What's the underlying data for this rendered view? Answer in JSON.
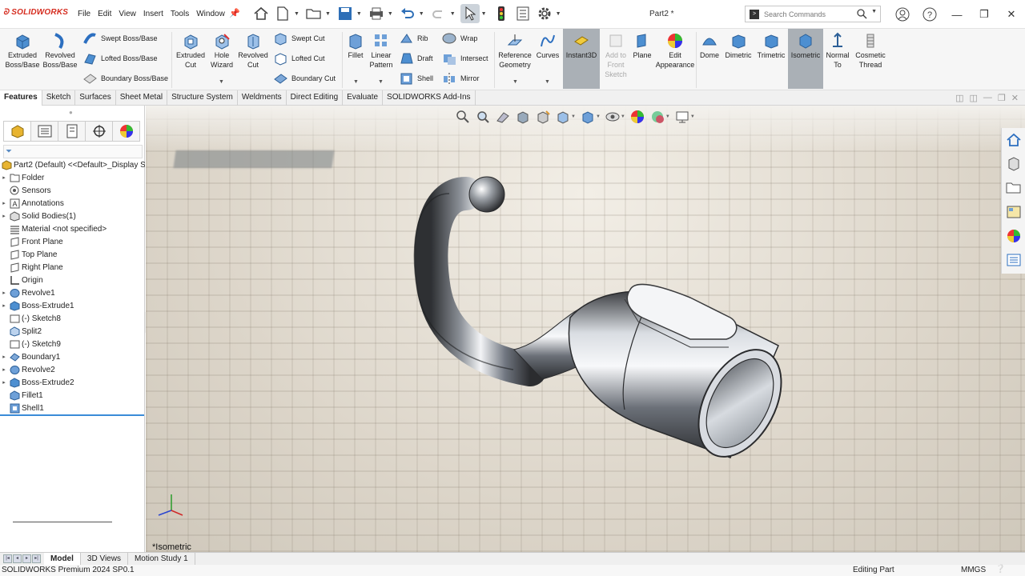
{
  "app": {
    "logo": "SOLIDWORKS",
    "title": "Part2 *"
  },
  "menus": [
    "File",
    "Edit",
    "View",
    "Insert",
    "Tools",
    "Window"
  ],
  "search": {
    "placeholder": "Search Commands"
  },
  "ribbon": {
    "extruded_boss": "Extruded Boss/Base",
    "revolved_boss": "Revolved Boss/Base",
    "swept_boss": "Swept Boss/Base",
    "lofted_boss": "Lofted Boss/Base",
    "boundary_boss": "Boundary Boss/Base",
    "extruded_cut": "Extruded Cut",
    "hole_wizard": "Hole Wizard",
    "revolved_cut": "Revolved Cut",
    "swept_cut": "Swept Cut",
    "lofted_cut": "Lofted Cut",
    "boundary_cut": "Boundary Cut",
    "fillet": "Fillet",
    "linear_pattern": "Linear Pattern",
    "rib": "Rib",
    "draft": "Draft",
    "shell": "Shell",
    "wrap": "Wrap",
    "intersect": "Intersect",
    "mirror": "Mirror",
    "reference_geometry": "Reference Geometry",
    "curves": "Curves",
    "instant3d": "Instant3D",
    "add_to_sketch": "Add to Front Sketch",
    "plane": "Plane",
    "edit_appearance": "Edit Appearance",
    "dome": "Dome",
    "dimetric": "Dimetric",
    "trimetric": "Trimetric",
    "isometric": "Isometric",
    "normal_to": "Normal To",
    "cosmetic_thread": "Cosmetic Thread"
  },
  "tabs": [
    "Features",
    "Sketch",
    "Surfaces",
    "Sheet Metal",
    "Structure System",
    "Weldments",
    "Direct Editing",
    "Evaluate",
    "SOLIDWORKS Add-Ins"
  ],
  "tree": [
    {
      "label": "Part2 (Default) <<Default>_Display S",
      "icon": "part-icon",
      "exp": ""
    },
    {
      "label": "Folder",
      "icon": "folder-icon",
      "exp": "▸"
    },
    {
      "label": "Sensors",
      "icon": "sensor-icon",
      "exp": ""
    },
    {
      "label": "Annotations",
      "icon": "annotation-icon",
      "exp": "▸"
    },
    {
      "label": "Solid Bodies(1)",
      "icon": "solid-bodies-icon",
      "exp": "▸"
    },
    {
      "label": "Material <not specified>",
      "icon": "material-icon",
      "exp": ""
    },
    {
      "label": "Front Plane",
      "icon": "plane-icon",
      "exp": ""
    },
    {
      "label": "Top Plane",
      "icon": "plane-icon",
      "exp": ""
    },
    {
      "label": "Right Plane",
      "icon": "plane-icon",
      "exp": ""
    },
    {
      "label": "Origin",
      "icon": "origin-icon",
      "exp": ""
    },
    {
      "label": "Revolve1",
      "icon": "revolve-icon",
      "exp": "▸"
    },
    {
      "label": "Boss-Extrude1",
      "icon": "extrude-icon",
      "exp": "▸"
    },
    {
      "label": "(-) Sketch8",
      "icon": "sketch-icon",
      "exp": ""
    },
    {
      "label": "Split2",
      "icon": "split-icon",
      "exp": ""
    },
    {
      "label": "(-) Sketch9",
      "icon": "sketch-icon",
      "exp": ""
    },
    {
      "label": "Boundary1",
      "icon": "boundary-icon",
      "exp": "▸"
    },
    {
      "label": "Revolve2",
      "icon": "revolve-icon",
      "exp": "▸"
    },
    {
      "label": "Boss-Extrude2",
      "icon": "extrude-icon",
      "exp": "▸"
    },
    {
      "label": "Fillet1",
      "icon": "fillet-icon",
      "exp": ""
    },
    {
      "label": "Shell1",
      "icon": "shell-icon",
      "exp": ""
    }
  ],
  "viewport": {
    "view_label": "*Isometric"
  },
  "bottom_tabs": [
    "Model",
    "3D Views",
    "Motion Study 1"
  ],
  "status": {
    "product": "SOLIDWORKS Premium 2024 SP0.1",
    "mode": "Editing Part",
    "units": "MMGS"
  },
  "colors": {
    "accent": "#3a8bd8",
    "brand": "#d52b1e",
    "highlight": "#aab0b6"
  }
}
